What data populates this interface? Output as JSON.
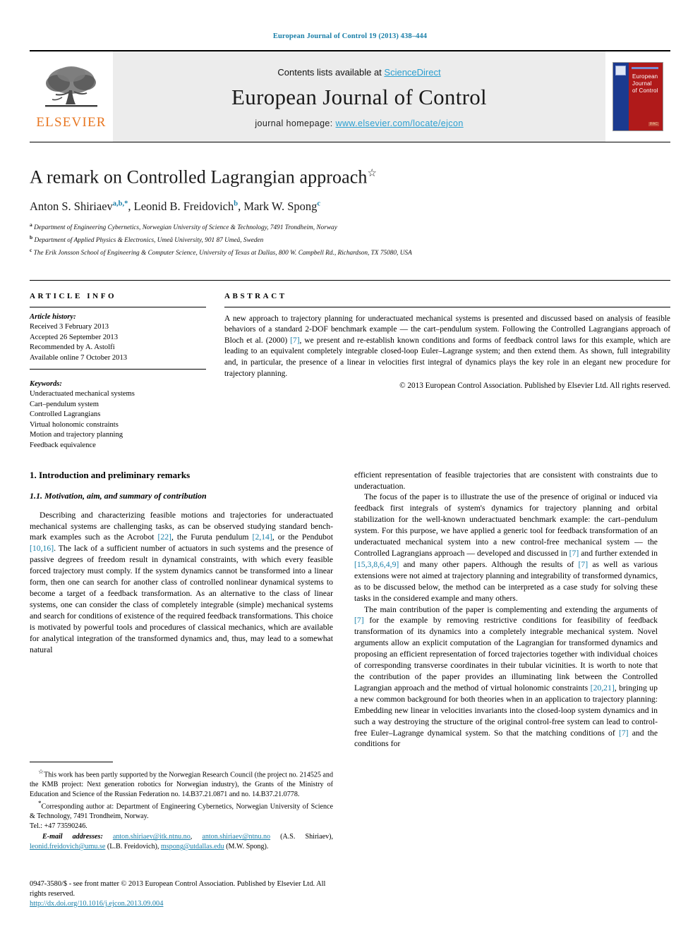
{
  "running_head": "European Journal of Control 19 (2013) 438–444",
  "masthead": {
    "publisher_name": "ELSEVIER",
    "contents_prefix": "Contents lists available at ",
    "contents_link": "ScienceDirect",
    "journal_title": "European Journal of Control",
    "homepage_prefix": "journal homepage: ",
    "homepage_url": "www.elsevier.com/locate/ejcon",
    "cover": {
      "line1": "European",
      "line2": "Journal",
      "line3": "of Control",
      "badge": "IFAC"
    }
  },
  "article": {
    "title": "A remark on Controlled Lagrangian approach",
    "title_footnote_mark": "☆",
    "authors": [
      {
        "name": "Anton S. Shiriaev",
        "marks": "a,b,*"
      },
      {
        "name": "Leonid B. Freidovich",
        "marks": "b"
      },
      {
        "name": "Mark W. Spong",
        "marks": "c"
      }
    ],
    "affiliations": [
      {
        "mark": "a",
        "text": "Department of Engineering Cybernetics, Norwegian University of Science & Technology, 7491 Trondheim, Norway"
      },
      {
        "mark": "b",
        "text": "Department of Applied Physics & Electronics, Umeå University, 901 87 Umeå, Sweden"
      },
      {
        "mark": "c",
        "text": "The Erik Jonsson School of Engineering & Computer Science, University of Texas at Dallas, 800 W. Campbell Rd., Richardson, TX 75080, USA"
      }
    ]
  },
  "article_info": {
    "label": "ARTICLE INFO",
    "history_heading": "Article history:",
    "history": [
      "Received 3 February 2013",
      "Accepted 26 September 2013",
      "Recommended by A. Astolfi",
      "Available online 7 October 2013"
    ],
    "keywords_heading": "Keywords:",
    "keywords": [
      "Underactuated mechanical systems",
      "Cart–pendulum system",
      "Controlled Lagrangians",
      "Virtual holonomic constraints",
      "Motion and trajectory planning",
      "Feedback equivalence"
    ]
  },
  "abstract": {
    "label": "ABSTRACT",
    "part1": "A new approach to trajectory planning for underactuated mechanical systems is presented and discussed based on analysis of feasible behaviors of a standard 2-DOF benchmark example — the cart–pendulum system. Following the Controlled Lagrangians approach of Bloch et al. (2000) ",
    "ref1": "[7]",
    "part2": ", we present and re-establish known conditions and forms of feedback control laws for this example, which are leading to an equivalent completely integrable closed-loop Euler–Lagrange system; and then extend them. As shown, full integrability and, in particular, the presence of a linear in velocities first integral of dynamics plays the key role in an elegant new procedure for trajectory planning.",
    "copyright": "© 2013 European Control Association. Published by Elsevier Ltd. All rights reserved."
  },
  "body": {
    "section_number_title": "1. Introduction and preliminary remarks",
    "subsection_number_title": "1.1. Motivation, aim, and summary of contribution",
    "left_paragraphs": [
      {
        "segments": [
          {
            "t": "Describing and characterizing feasible motions and trajectories for underactuated mechanical systems are challenging tasks, as can be observed studying standard bench-mark examples such as the Acrobot "
          },
          {
            "t": "[22]",
            "ref": true
          },
          {
            "t": ", the Furuta pendulum "
          },
          {
            "t": "[2,14]",
            "ref": true
          },
          {
            "t": ", or the Pendubot "
          },
          {
            "t": "[10,16]",
            "ref": true
          },
          {
            "t": ". The lack of a sufficient number of actuators in such systems and the presence of passive degrees of freedom result in dynamical constraints, with which every feasible forced trajectory must comply. If the system dynamics cannot be transformed into a linear form, then one can search for another class of controlled nonlinear dynamical systems to become a target of a feedback transformation. As an alternative to the class of linear systems, one can consider the class of completely integrable (simple) mechanical systems and search for conditions of existence of the required feedback transformations. This choice is motivated by powerful tools and procedures of classical mechanics, which are available for analytical integration of the transformed dynamics and, thus, may lead to a somewhat natural"
          }
        ]
      }
    ],
    "right_paragraphs": [
      {
        "indent": false,
        "segments": [
          {
            "t": "efficient representation of feasible trajectories that are consistent with constraints due to underactuation."
          }
        ]
      },
      {
        "indent": true,
        "segments": [
          {
            "t": "The focus of the paper is to illustrate the use of the presence of original or induced via feedback first integrals of system's dynamics for trajectory planning and orbital stabilization for the well-known underactuated benchmark example: the cart–pendulum system. For this purpose, we have applied a generic tool for feedback transformation of an underactuated mechanical system into a new control-free mechanical system — the Controlled Lagrangians approach — developed and discussed in "
          },
          {
            "t": "[7]",
            "ref": true
          },
          {
            "t": " and further extended in "
          },
          {
            "t": "[15,3,8,6,4,9]",
            "ref": true
          },
          {
            "t": " and many other papers. Although the results of "
          },
          {
            "t": "[7]",
            "ref": true
          },
          {
            "t": " as well as various extensions were not aimed at trajectory planning and integrability of transformed dynamics, as to be discussed below, the method can be interpreted as a case study for solving these tasks in the considered example and many others."
          }
        ]
      },
      {
        "indent": true,
        "segments": [
          {
            "t": "The main contribution of the paper is complementing and extending the arguments of "
          },
          {
            "t": "[7]",
            "ref": true
          },
          {
            "t": " for the example by removing restrictive conditions for feasibility of feedback transformation of its dynamics into a completely integrable mechanical system. Novel arguments allow an explicit computation of the Lagrangian for transformed dynamics and proposing an efficient representation of forced trajectories together with individual choices of corresponding transverse coordinates in their tubular vicinities. It is worth to note that the contribution of the paper provides an illuminating link between the Controlled Lagrangian approach and the method of virtual holonomic constraints "
          },
          {
            "t": "[20,21]",
            "ref": true
          },
          {
            "t": ", bringing up a new common background for both theories when in an application to trajectory planning: Embedding new linear in velocities invariants into the closed-loop system dynamics and in such a way destroying the structure of the original control-free system can lead to control-free Euler–Lagrange dynamical system. So that the matching conditions of "
          },
          {
            "t": "[7]",
            "ref": true
          },
          {
            "t": " and the conditions for"
          }
        ]
      }
    ]
  },
  "footnotes": {
    "funding_mark": "☆",
    "funding": "This work has been partly supported by the Norwegian Research Council (the project no. 214525 and the KMB project: Next generation robotics for Norwegian industry), the Grants of the Ministry of Education and Science of the Russian Federation no. 14.B37.21.0871 and no. 14.B37.21.0778.",
    "corresponding_mark": "*",
    "corresponding": "Corresponding author at: Department of Engineering Cybernetics, Norwegian University of Science & Technology, 7491 Trondheim, Norway.",
    "tel": "Tel.: +47 73590246.",
    "email_label": "E-mail addresses:",
    "emails": [
      {
        "addr": "anton.shiriaev@itk.ntnu.no",
        "who": ""
      },
      {
        "addr": "anton.shiriaev@ntnu.no",
        "who": " (A.S. Shiriaev), "
      },
      {
        "addr": "leonid.freidovich@umu.se",
        "who": " (L.B. Freidovich), "
      },
      {
        "addr": "mspong@utdallas.edu",
        "who": " (M.W. Spong)."
      }
    ]
  },
  "bottom": {
    "issn_line": "0947-3580/$ - see front matter © 2013 European Control Association. Published by Elsevier Ltd. All rights reserved.",
    "doi": "http://dx.doi.org/10.1016/j.ejcon.2013.09.004"
  },
  "colors": {
    "link": "#1a7fa8",
    "elsevier_orange": "#E87722",
    "sciencedirect": "#2a9fd0"
  }
}
